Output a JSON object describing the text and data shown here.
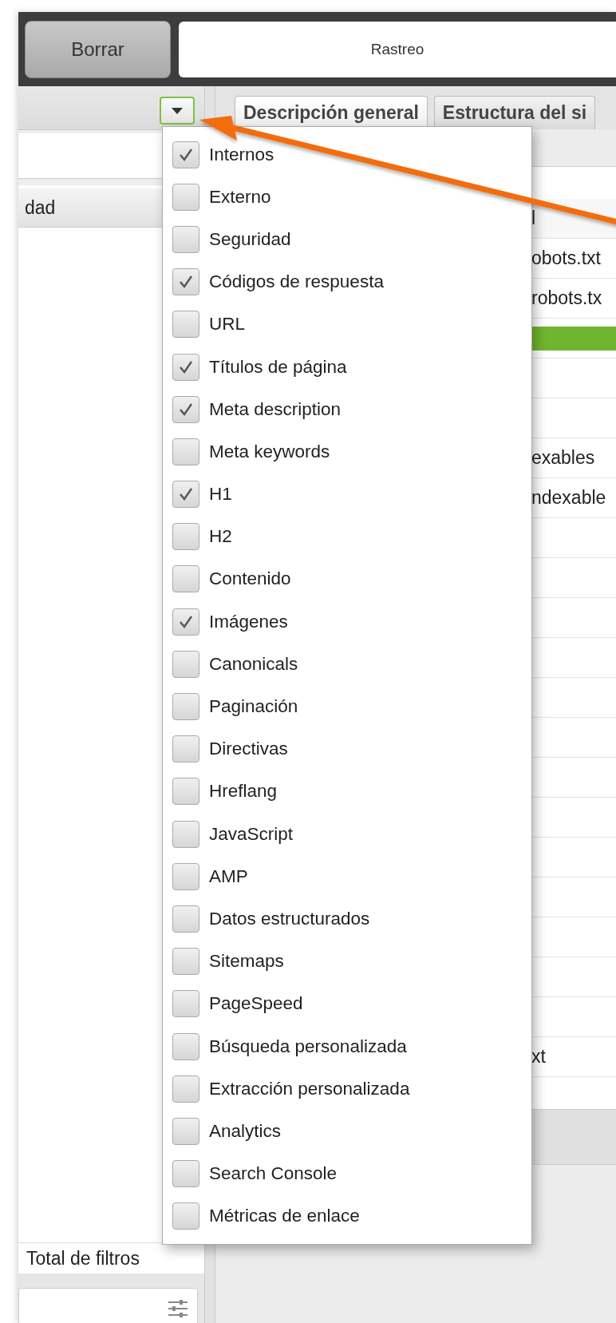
{
  "toolbar": {
    "clear_button": "Borrar",
    "crawl_field": "Rastreo"
  },
  "left_panel": {
    "column_header": "dad",
    "footer": "Total de filtros"
  },
  "tabs": [
    {
      "label": "Descripción general",
      "selected": true
    },
    {
      "label": "Estructura del si",
      "selected": false
    }
  ],
  "right_rows": [
    {
      "kind": "header",
      "text": "l"
    },
    {
      "kind": "text",
      "text": "obots.txt"
    },
    {
      "kind": "text",
      "text": "robots.tx"
    },
    {
      "kind": "bar"
    },
    {
      "kind": "blank"
    },
    {
      "kind": "blank"
    },
    {
      "kind": "text",
      "text": "exables"
    },
    {
      "kind": "text",
      "text": "ndexable"
    },
    {
      "kind": "blank"
    },
    {
      "kind": "blank"
    },
    {
      "kind": "blank"
    },
    {
      "kind": "blank"
    },
    {
      "kind": "blank"
    },
    {
      "kind": "blank"
    },
    {
      "kind": "blank"
    },
    {
      "kind": "blank"
    },
    {
      "kind": "blank"
    },
    {
      "kind": "blank"
    },
    {
      "kind": "blank"
    },
    {
      "kind": "blank"
    },
    {
      "kind": "blank"
    },
    {
      "kind": "text",
      "text": "xt"
    }
  ],
  "filter_menu": {
    "items": [
      {
        "label": "Internos",
        "checked": true
      },
      {
        "label": "Externo",
        "checked": false
      },
      {
        "label": "Seguridad",
        "checked": false
      },
      {
        "label": "Códigos de respuesta",
        "checked": true
      },
      {
        "label": "URL",
        "checked": false
      },
      {
        "label": "Títulos de página",
        "checked": true
      },
      {
        "label": "Meta description",
        "checked": true
      },
      {
        "label": "Meta keywords",
        "checked": false
      },
      {
        "label": "H1",
        "checked": true
      },
      {
        "label": "H2",
        "checked": false
      },
      {
        "label": "Contenido",
        "checked": false
      },
      {
        "label": "Imágenes",
        "checked": true
      },
      {
        "label": "Canonicals",
        "checked": false
      },
      {
        "label": "Paginación",
        "checked": false
      },
      {
        "label": "Directivas",
        "checked": false
      },
      {
        "label": "Hreflang",
        "checked": false
      },
      {
        "label": "JavaScript",
        "checked": false
      },
      {
        "label": "AMP",
        "checked": false
      },
      {
        "label": "Datos estructurados",
        "checked": false
      },
      {
        "label": "Sitemaps",
        "checked": false
      },
      {
        "label": "PageSpeed",
        "checked": false
      },
      {
        "label": "Búsqueda personalizada",
        "checked": false
      },
      {
        "label": "Extracción personalizada",
        "checked": false
      },
      {
        "label": "Analytics",
        "checked": false
      },
      {
        "label": "Search Console",
        "checked": false
      },
      {
        "label": "Métricas de enlace",
        "checked": false
      }
    ]
  }
}
